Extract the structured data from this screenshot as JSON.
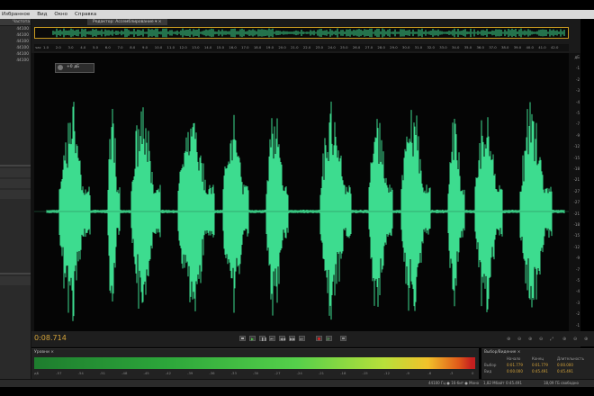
{
  "menu": [
    "Избранное",
    "Вид",
    "Окно",
    "Справка"
  ],
  "left_panel": {
    "header": "Частота",
    "rows": [
      "44100",
      "44100",
      "44100",
      "44100",
      "44100",
      "44100"
    ]
  },
  "editor": {
    "tab_label": "Редактор: Ассемблирование ▾ ×",
    "ruler_unit": "час",
    "ruler_ticks": [
      "1.0",
      "2.0",
      "3.0",
      "4.0",
      "5.0",
      "6.0",
      "7.0",
      "8.0",
      "9.0",
      "10.0",
      "11.0",
      "12.0",
      "13.0",
      "14.0",
      "15.0",
      "16.0",
      "17.0",
      "18.0",
      "19.0",
      "20.0",
      "21.0",
      "22.0",
      "23.0",
      "24.0",
      "25.0",
      "26.0",
      "27.0",
      "28.0",
      "29.0",
      "30.0",
      "31.0",
      "32.0",
      "33.0",
      "34.0",
      "35.0",
      "36.0",
      "37.0",
      "38.0",
      "39.0",
      "40.0",
      "41.0",
      "42.0"
    ],
    "hud_value": "+0 дБ",
    "db_scale": [
      "дБ",
      "-1",
      "-2",
      "-3",
      "-4",
      "-5",
      "-7",
      "-9",
      "-12",
      "-15",
      "-18",
      "-21",
      "-27",
      "-27",
      "-21",
      "-18",
      "-15",
      "-12",
      "-9",
      "-7",
      "-5",
      "-4",
      "-3",
      "-2",
      "-1"
    ]
  },
  "transport": {
    "timecode": "0:08.714",
    "buttons": [
      "stop-button",
      "play-button",
      "pause-button",
      "go-start-button",
      "rewind-button",
      "fast-forward-button",
      "go-end-button",
      "record-button",
      "loop-button",
      "skip-selection-button"
    ]
  },
  "levels": {
    "title": "Уровни ×",
    "scale": [
      "дБ",
      "-57",
      "-54",
      "-51",
      "-48",
      "-45",
      "-42",
      "-39",
      "-36",
      "-33",
      "-30",
      "-27",
      "-24",
      "-21",
      "-18",
      "-15",
      "-12",
      "-9",
      "-6",
      "-3",
      "0"
    ]
  },
  "selection": {
    "title": "Выбор/Видение ×",
    "headers": [
      "Начало",
      "Конец",
      "Длительность"
    ],
    "rows": [
      {
        "label": "Выбор",
        "start": "0:01.779",
        "end": "0:01.779",
        "dur": "0:00.000"
      },
      {
        "label": "Вид",
        "start": "0:00.000",
        "end": "0:45.491",
        "dur": "0:45.491"
      }
    ]
  },
  "status": {
    "format": "44100 Гц ● 16-бит ● Моно",
    "size": "1,82 Мбайт",
    "duration": "0:45.491",
    "free": "18,09 ГБ свободно"
  }
}
